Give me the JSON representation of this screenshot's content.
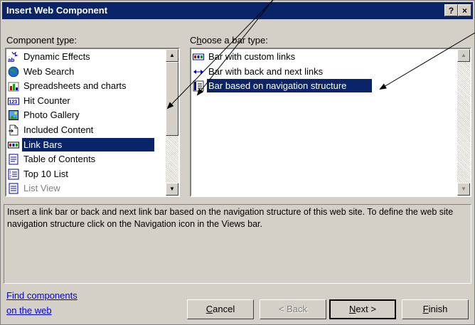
{
  "window": {
    "title": "Insert Web Component",
    "help_label": "?",
    "close_label": "×"
  },
  "component_panel": {
    "label": "Component type:",
    "items": [
      {
        "label": "Dynamic Effects",
        "icon": "dynamic-effects-icon"
      },
      {
        "label": "Web Search",
        "icon": "web-search-icon"
      },
      {
        "label": "Spreadsheets and charts",
        "icon": "spreadsheet-chart-icon"
      },
      {
        "label": "Hit Counter",
        "icon": "hit-counter-icon"
      },
      {
        "label": "Photo Gallery",
        "icon": "photo-gallery-icon"
      },
      {
        "label": "Included Content",
        "icon": "included-content-icon"
      },
      {
        "label": "Link Bars",
        "icon": "link-bars-icon",
        "selected": true
      },
      {
        "label": "Table of Contents",
        "icon": "table-of-contents-icon"
      },
      {
        "label": "Top 10 List",
        "icon": "top-10-list-icon"
      },
      {
        "label": "List View",
        "icon": "list-view-icon",
        "disabled": true
      }
    ]
  },
  "bar_panel": {
    "label": "Choose a bar type:",
    "items": [
      {
        "label": "Bar with custom links",
        "icon": "custom-links-icon"
      },
      {
        "label": "Bar with back and next links",
        "icon": "back-next-arrows-icon"
      },
      {
        "label": "Bar based on navigation structure",
        "icon": "navigation-structure-icon",
        "selected": true
      }
    ]
  },
  "description": "Insert a link bar or back and next link bar based on the navigation structure of this web site.  To define the web site navigation structure click on the Navigation icon in the Views bar.",
  "find_link": {
    "line1": "Find components",
    "line2": "on the web"
  },
  "buttons": {
    "cancel": "Cancel",
    "back": "< Back",
    "next": "Next >",
    "finish": "Finish"
  },
  "colors": {
    "title_bar": "#0a246a",
    "selection": "#0a246a",
    "face": "#d4d0c8",
    "link": "#0000ee"
  }
}
